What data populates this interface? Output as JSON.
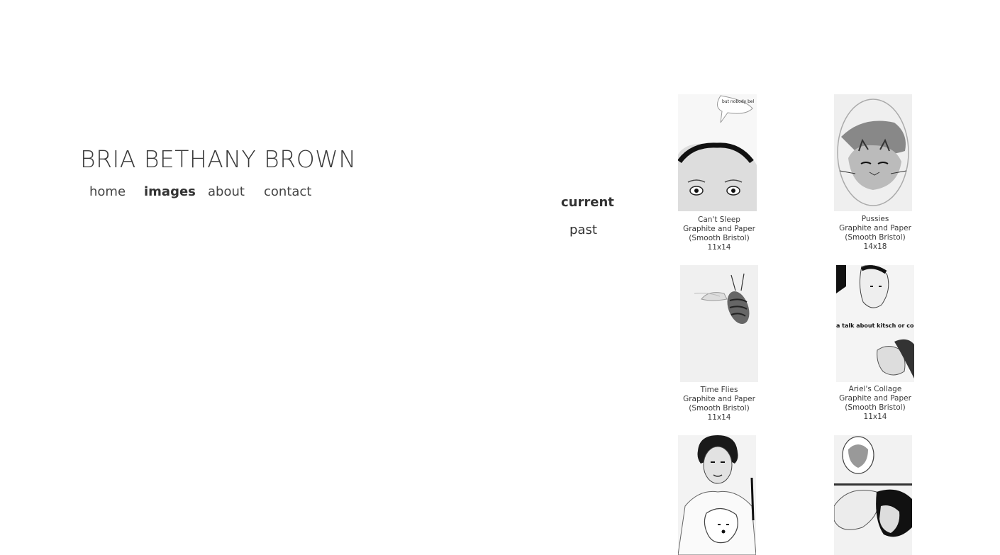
{
  "site": {
    "title": "BRIA BETHANY BROWN"
  },
  "nav": [
    {
      "label": "home",
      "active": false
    },
    {
      "label": "images",
      "active": true
    },
    {
      "label": "about",
      "active": false
    },
    {
      "label": "contact",
      "active": false
    }
  ],
  "subnav": [
    {
      "label": "current",
      "active": true
    },
    {
      "label": "past",
      "active": false
    }
  ],
  "gallery": [
    {
      "title": "Can't Sleep",
      "medium": "Graphite and Paper",
      "paper": "(Smooth Bristol)",
      "size": "11x14",
      "artwork_text": [
        "but nobody bel"
      ]
    },
    {
      "title": "Pussies",
      "medium": "Graphite and Paper",
      "paper": "(Smooth Bristol)",
      "size": "14x18"
    },
    {
      "title": "Time Flies",
      "medium": "Graphite and Paper",
      "paper": "(Smooth Bristol)",
      "size": "11x14"
    },
    {
      "title": "Ariel's Collage",
      "medium": "Graphite and Paper",
      "paper": "(Smooth Bristol)",
      "size": "11x14",
      "artwork_text": [
        "a talk about kitsch or co"
      ]
    },
    {
      "title": "",
      "medium": "",
      "paper": "",
      "size": ""
    },
    {
      "title": "",
      "medium": "",
      "paper": "",
      "size": ""
    }
  ]
}
